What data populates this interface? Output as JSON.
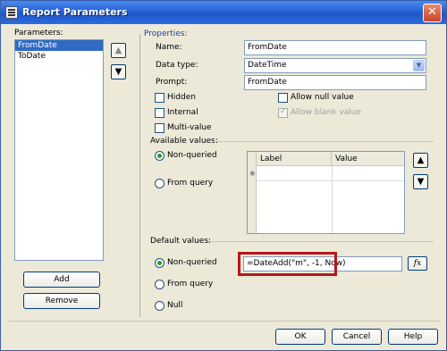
{
  "window": {
    "title": "Report Parameters",
    "close_glyph": "✕"
  },
  "parameters": {
    "label": "Parameters:",
    "items": [
      {
        "label": "FromDate",
        "selected": true
      },
      {
        "label": "ToDate",
        "selected": false
      }
    ],
    "add_label": "Add",
    "remove_label": "Remove"
  },
  "properties": {
    "heading": "Properties:",
    "name_label": "Name:",
    "name_value": "FromDate",
    "datatype_label": "Data type:",
    "datatype_value": "DateTime",
    "prompt_label": "Prompt:",
    "prompt_value": "FromDate",
    "hidden_label": "Hidden",
    "internal_label": "Internal",
    "multivalue_label": "Multi-value",
    "allow_null_label": "Allow null value",
    "allow_blank_label": "Allow blank value"
  },
  "available_values": {
    "heading": "Available values:",
    "non_queried_label": "Non-queried",
    "from_query_label": "From query",
    "columns": [
      "Label",
      "Value"
    ]
  },
  "default_values": {
    "heading": "Default values:",
    "non_queried_label": "Non-queried",
    "from_query_label": "From query",
    "null_label": "Null",
    "expression": "=DateAdd(\"m\", -1, Now)",
    "fx_label": "fx"
  },
  "footer": {
    "ok_label": "OK",
    "cancel_label": "Cancel",
    "help_label": "Help"
  }
}
